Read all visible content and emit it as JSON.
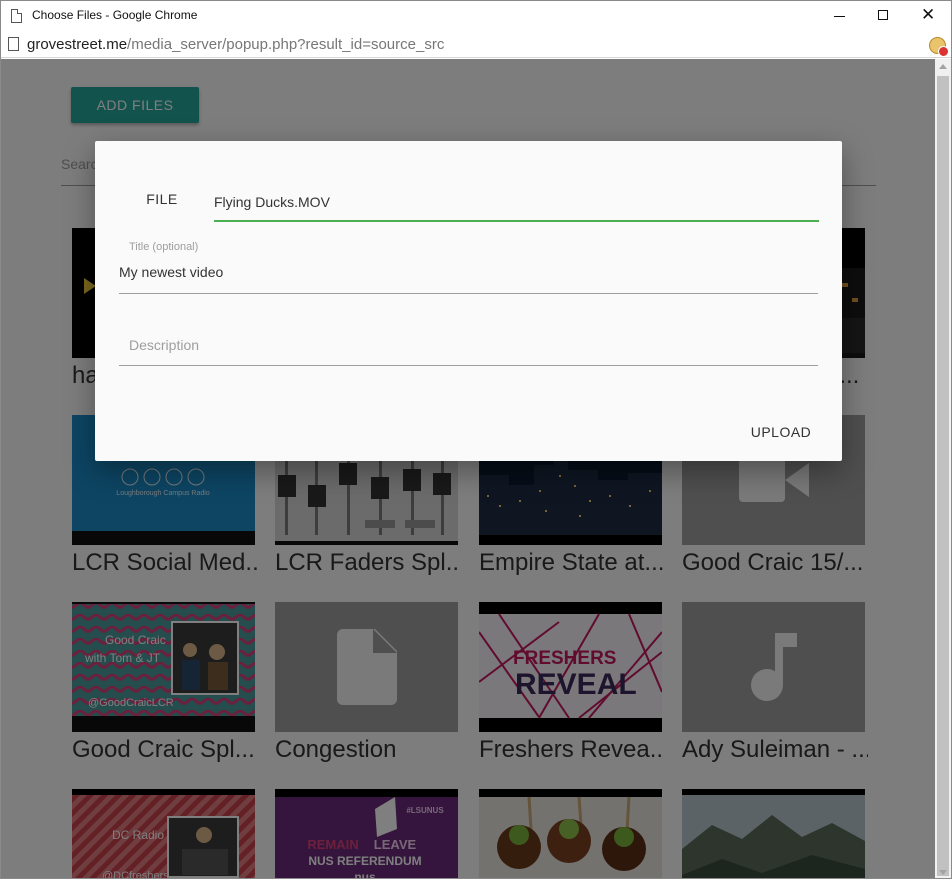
{
  "window": {
    "title": "Choose Files - Google Chrome",
    "url_domain": "grovestreet.me",
    "url_path": "/media_server/popup.php?result_id=source_src",
    "min_glyph": "—",
    "close_glyph": "✕"
  },
  "page": {
    "add_files_label": "ADD FILES",
    "search_placeholder": "Search",
    "row1_left_title": "ha",
    "row1_right_title": "i...",
    "cards": [
      {
        "title": "LCR Social Med...",
        "thumb": "lcr-social",
        "social_caption": "Loughborough Campus Radio"
      },
      {
        "title": "LCR Faders Spl...",
        "thumb": "faders"
      },
      {
        "title": "Empire State at...",
        "thumb": "city-night"
      },
      {
        "title": "Good Craic 15/...",
        "thumb": "video-icon"
      },
      {
        "title": "Good Craic Spl...",
        "thumb": "good-craic",
        "thumb_text": [
          "Good Craic",
          "with Tom & JT",
          "@GoodCraicLCR"
        ]
      },
      {
        "title": "Congestion",
        "thumb": "file-icon"
      },
      {
        "title": "Freshers Revea...",
        "thumb": "freshers",
        "thumb_text": [
          "FRESHERS",
          "REVEAL"
        ]
      },
      {
        "title": "Ady Suleiman - ...",
        "thumb": "music-icon"
      },
      {
        "title": "",
        "thumb": "dc-radio",
        "thumb_text": [
          "DC Radio",
          "@DCfreshers"
        ]
      },
      {
        "title": "",
        "thumb": "nus",
        "thumb_text": [
          "REMAIN",
          "LEAVE",
          "NUS REFERENDUM",
          "nus",
          "#LSUNUS"
        ]
      },
      {
        "title": "",
        "thumb": "apples"
      },
      {
        "title": "",
        "thumb": "mountains"
      }
    ]
  },
  "modal": {
    "file_button_label": "FILE",
    "file_value": "Flying Ducks.MOV",
    "title_label": "Title (optional)",
    "title_value": "My newest video",
    "description_placeholder": "Description",
    "upload_label": "UPLOAD"
  },
  "colors": {
    "accent": "#26a69a",
    "active_underline": "#4caf50",
    "overlay": "rgba(0,0,0,0.5)"
  }
}
